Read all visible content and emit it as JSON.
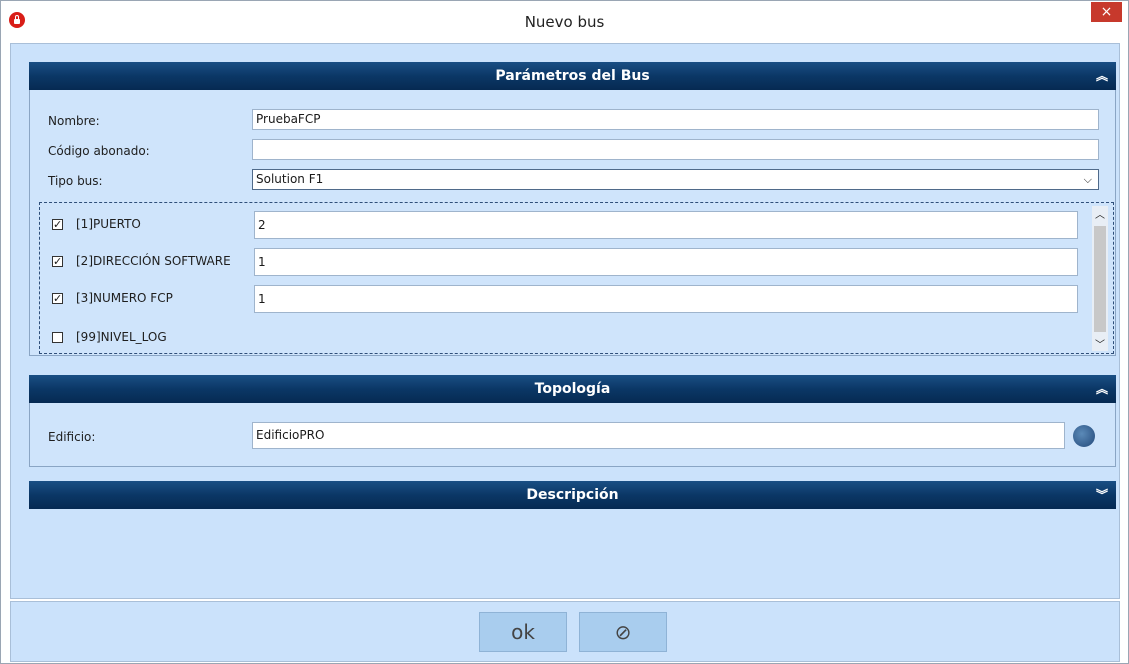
{
  "window": {
    "title": "Nuevo bus",
    "close": "×"
  },
  "sections": {
    "parametros": {
      "title": "Parámetros del Bus",
      "chevron": "≈"
    },
    "topologia": {
      "title": "Topología",
      "chevron": "≈"
    },
    "descripcion": {
      "title": "Descripción",
      "chevron": "≈"
    }
  },
  "fields": {
    "nombre": {
      "label": "Nombre:",
      "value": "PruebaFCP"
    },
    "codigo": {
      "label": "Código abonado:",
      "value": ""
    },
    "tipo": {
      "label": "Tipo bus:",
      "value": "Solution F1"
    }
  },
  "params": [
    {
      "label": "[1]PUERTO",
      "checked": true,
      "value": "2"
    },
    {
      "label": "[2]DIRECCIÓN SOFTWARE",
      "checked": true,
      "value": "1"
    },
    {
      "label": "[3]NUMERO FCP",
      "checked": true,
      "value": "1"
    },
    {
      "label": "[99]NIVEL_LOG",
      "checked": false,
      "value": ""
    }
  ],
  "topology": {
    "label": "Edificio:",
    "value": "EdificioPRO"
  },
  "buttons": {
    "ok": "ok",
    "cancel": "⊘"
  }
}
